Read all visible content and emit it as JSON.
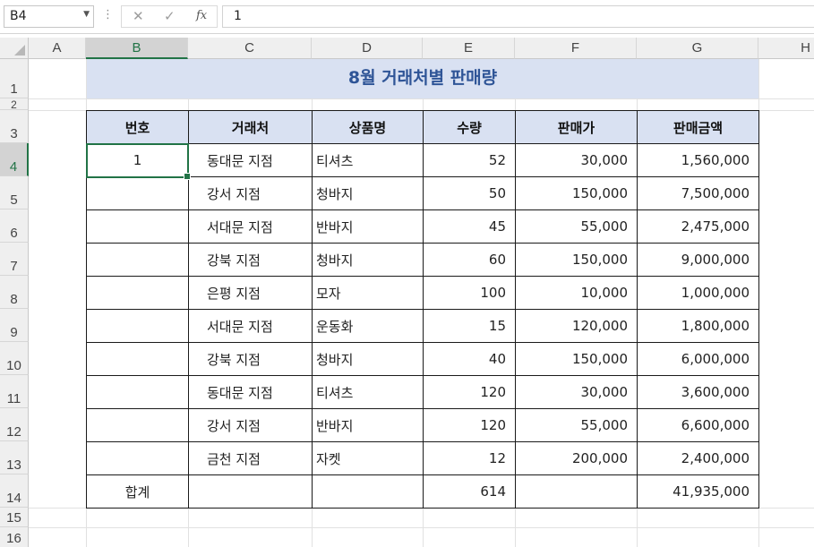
{
  "formula_bar": {
    "name_box": "B4",
    "formula_value": "1",
    "cancel_glyph": "✕",
    "enter_glyph": "✓",
    "fx_glyph": "fx"
  },
  "columns": [
    "A",
    "B",
    "C",
    "D",
    "E",
    "F",
    "G",
    "H"
  ],
  "rows": [
    "1",
    "2",
    "3",
    "4",
    "5",
    "6",
    "7",
    "8",
    "9",
    "10",
    "11",
    "12",
    "13",
    "14",
    "15",
    "16"
  ],
  "selected": {
    "column": "B",
    "row": "4"
  },
  "colors": {
    "header_fill": "#d9e1f2",
    "title_text": "#2f5597",
    "selection": "#217346"
  },
  "sheet": {
    "title": "8월 거래처별 판매량",
    "headers": [
      "번호",
      "거래처",
      "상품명",
      "수량",
      "판매가",
      "판매금액"
    ],
    "rows": [
      {
        "no": "1",
        "store": "동대문 지점",
        "product": "티셔츠",
        "qty": "52",
        "price": "30,000",
        "amount": "1,560,000"
      },
      {
        "no": "",
        "store": "강서 지점",
        "product": "청바지",
        "qty": "50",
        "price": "150,000",
        "amount": "7,500,000"
      },
      {
        "no": "",
        "store": "서대문 지점",
        "product": "반바지",
        "qty": "45",
        "price": "55,000",
        "amount": "2,475,000"
      },
      {
        "no": "",
        "store": "강북 지점",
        "product": "청바지",
        "qty": "60",
        "price": "150,000",
        "amount": "9,000,000"
      },
      {
        "no": "",
        "store": "은평 지점",
        "product": "모자",
        "qty": "100",
        "price": "10,000",
        "amount": "1,000,000"
      },
      {
        "no": "",
        "store": "서대문 지점",
        "product": "운동화",
        "qty": "15",
        "price": "120,000",
        "amount": "1,800,000"
      },
      {
        "no": "",
        "store": "강북 지점",
        "product": "청바지",
        "qty": "40",
        "price": "150,000",
        "amount": "6,000,000"
      },
      {
        "no": "",
        "store": "동대문 지점",
        "product": "티셔츠",
        "qty": "120",
        "price": "30,000",
        "amount": "3,600,000"
      },
      {
        "no": "",
        "store": "강서 지점",
        "product": "반바지",
        "qty": "120",
        "price": "55,000",
        "amount": "6,600,000"
      },
      {
        "no": "",
        "store": "금천 지점",
        "product": "자켓",
        "qty": "12",
        "price": "200,000",
        "amount": "2,400,000"
      }
    ],
    "total": {
      "label": "합계",
      "store": "",
      "product": "",
      "qty": "614",
      "price": "",
      "amount": "41,935,000"
    }
  }
}
